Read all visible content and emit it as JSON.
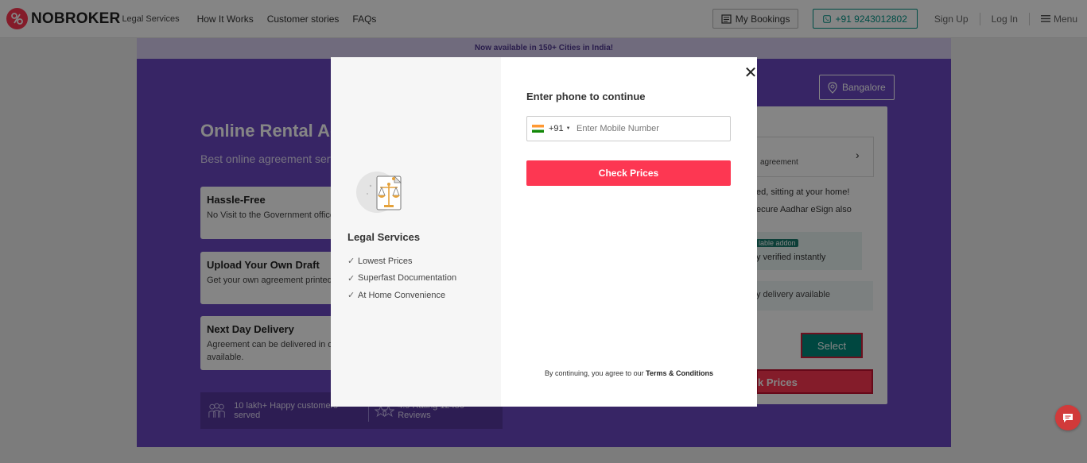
{
  "header": {
    "logo_text": "NOBROKER",
    "logo_sub": "Legal Services",
    "nav": [
      "How It Works",
      "Customer stories",
      "FAQs"
    ],
    "bookings_label": "My Bookings",
    "phone_label": "+91 9243012802",
    "signup_label": "Sign Up",
    "login_label": "Log In",
    "menu_label": "Menu"
  },
  "strip_text": "Now available in 150+ Cities in India!",
  "hero": {
    "title": "Online Rental Ag",
    "subtitle": "Best online agreement serv",
    "features": [
      {
        "title": "Hassle-Free",
        "desc": "No Visit to the Government office"
      },
      {
        "title": "Upload Your Own Draft",
        "desc": "Get your own agreement printed o"
      },
      {
        "title": "Next Day Delivery",
        "desc": "Agreement can be delivered in on",
        "desc2": "available."
      }
    ],
    "stats": [
      {
        "text": "10 lakh+ Happy customers served"
      },
      {
        "text": "4.9 Rating 12450 Reviews"
      }
    ],
    "city": "Bangalore",
    "card": {
      "box_text": "agreement",
      "line1": "ed, sitting at your home!",
      "line2": "ecure Aadhar eSign also",
      "addon_badge": "lable addon",
      "addon_text": "y verified instantly",
      "delivery": "y delivery available",
      "select_label": "Select",
      "check_label": "k Prices"
    }
  },
  "modal": {
    "left_title": "Legal Services",
    "benefits": [
      "Lowest Prices",
      "Superfast Documentation",
      "At Home Convenience"
    ],
    "title": "Enter phone to continue",
    "country_code": "+91",
    "phone_placeholder": "Enter Mobile Number",
    "button_label": "Check Prices",
    "terms_prefix": "By continuing, you agree to our",
    "terms_link": "Terms & Conditions"
  },
  "colors": {
    "brand": "#fd3752",
    "hero_purple": "#6a47c2",
    "teal": "#009587"
  }
}
